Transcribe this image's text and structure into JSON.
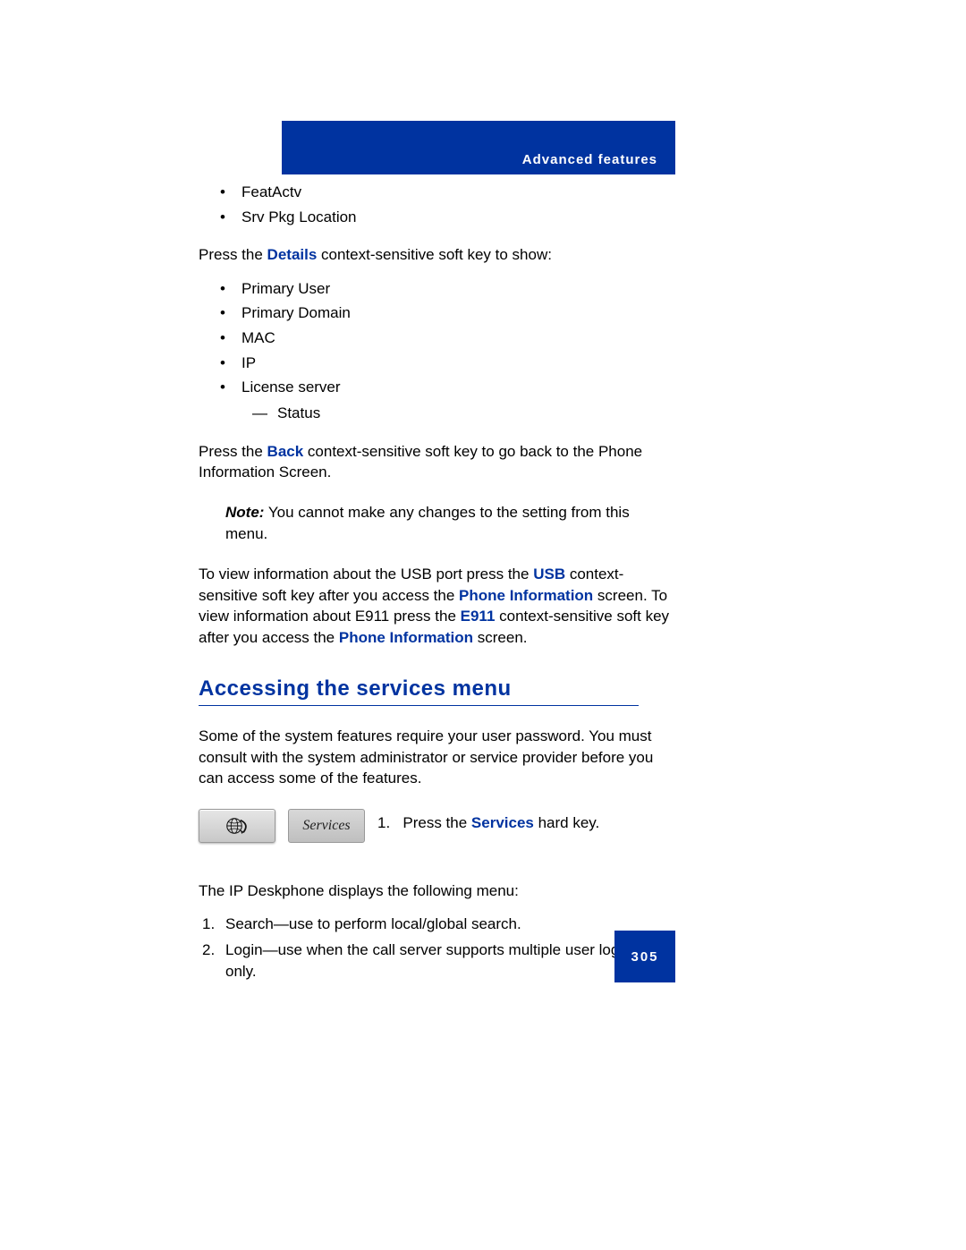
{
  "header": {
    "section": "Advanced features"
  },
  "top_bullets": [
    "FeatActv",
    "Srv Pkg Location"
  ],
  "para_details": {
    "t1": "Press the ",
    "link": "Details",
    "t2": " context-sensitive soft key to show:"
  },
  "details_bullets": {
    "items": [
      "Primary User",
      "Primary Domain",
      "MAC",
      "IP",
      "License server"
    ],
    "sub": [
      "Status"
    ]
  },
  "para_back": {
    "t1": "Press the ",
    "link": "Back",
    "t2": " context-sensitive soft key to go back to the Phone Information Screen."
  },
  "note": {
    "label": "Note:",
    "text": "  You cannot make any changes to the setting from this menu."
  },
  "para_usb": {
    "t1": "To view information about the USB port press the ",
    "l1": "USB",
    "t2": " context-sensitive soft key after you access the ",
    "l2": "Phone Information",
    "t3": " screen. To view information about E911 press the ",
    "l3": "E911",
    "t4": " context-sensitive soft key after you access the ",
    "l4": "Phone Information",
    "t5": " screen."
  },
  "heading": "Accessing the services menu",
  "para_intro": "Some of the system features require your user password. You must consult with the system administrator or service provider before you can access some of the features.",
  "step": {
    "button_label": "Services",
    "num": "1.",
    "t1": "Press the ",
    "link": "Services",
    "t2": " hard key."
  },
  "para_menu": "The IP Deskphone displays the following menu:",
  "menu_items": [
    "Search—use to perform local/global search.",
    "Login—use when the call server supports multiple user logons only."
  ],
  "page_number": "305"
}
